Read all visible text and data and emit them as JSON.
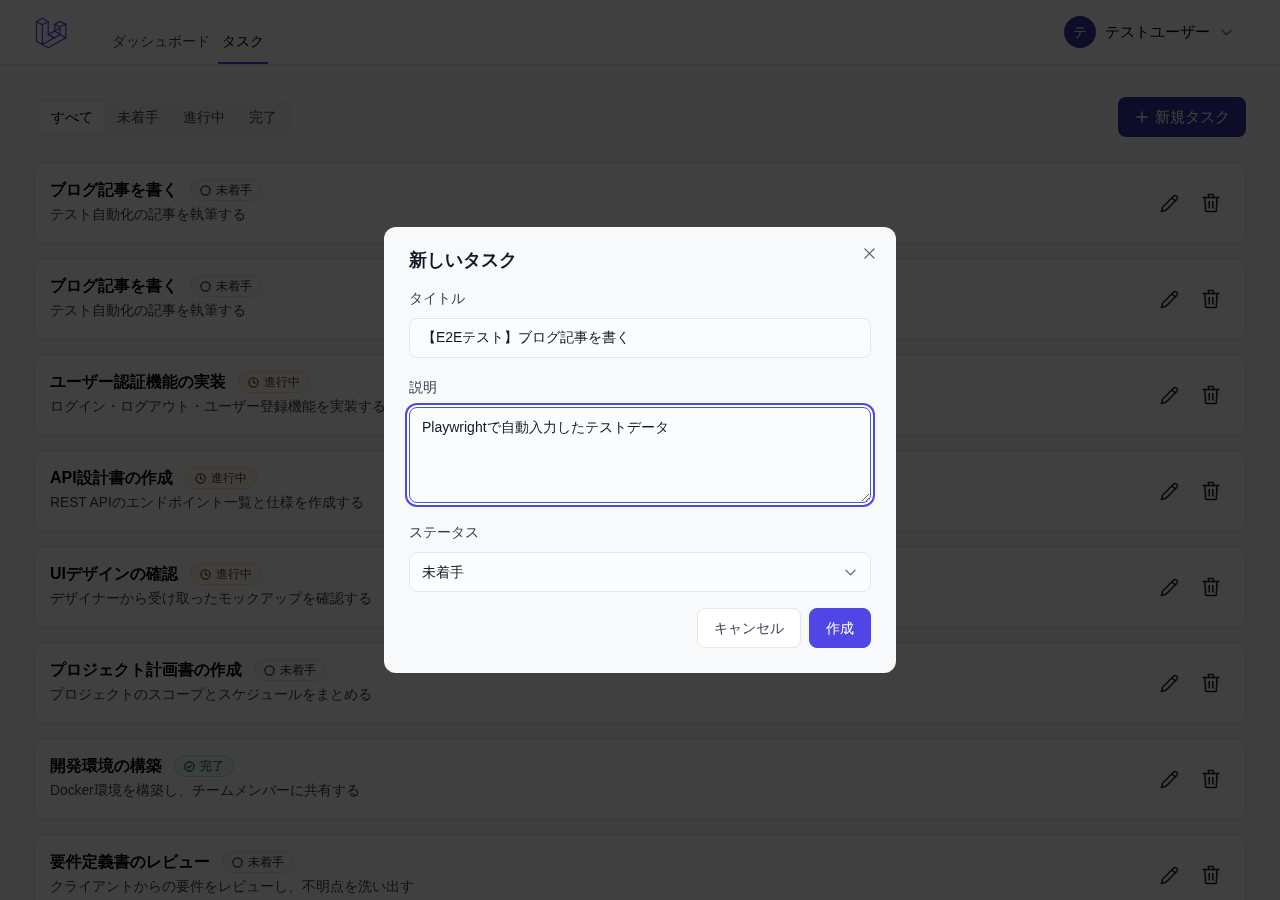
{
  "header": {
    "nav": [
      {
        "label": "ダッシュボード",
        "selected": false
      },
      {
        "label": "タスク",
        "selected": true
      }
    ],
    "user": {
      "avatar_initial": "テ",
      "name": "テストユーザー"
    }
  },
  "filters": [
    {
      "label": "すべて",
      "selected": true
    },
    {
      "label": "未着手",
      "selected": false
    },
    {
      "label": "進行中",
      "selected": false
    },
    {
      "label": "完了",
      "selected": false
    }
  ],
  "new_task_button": {
    "label": "新規タスク"
  },
  "tasks": [
    {
      "title": "ブログ記事を書く",
      "status": {
        "label": "未着手",
        "kind": "todo"
      },
      "description": "テスト自動化の記事を執筆する"
    },
    {
      "title": "ブログ記事を書く",
      "status": {
        "label": "未着手",
        "kind": "todo"
      },
      "description": "テスト自動化の記事を執筆する"
    },
    {
      "title": "ユーザー認証機能の実装",
      "status": {
        "label": "進行中",
        "kind": "in_progress"
      },
      "description": "ログイン・ログアウト・ユーザー登録機能を実装する"
    },
    {
      "title": "API設計書の作成",
      "status": {
        "label": "進行中",
        "kind": "in_progress"
      },
      "description": "REST APIのエンドポイント一覧と仕様を作成する"
    },
    {
      "title": "UIデザインの確認",
      "status": {
        "label": "進行中",
        "kind": "in_progress"
      },
      "description": "デザイナーから受け取ったモックアップを確認する"
    },
    {
      "title": "プロジェクト計画書の作成",
      "status": {
        "label": "未着手",
        "kind": "todo"
      },
      "description": "プロジェクトのスコープとスケジュールをまとめる"
    },
    {
      "title": "開発環境の構築",
      "status": {
        "label": "完了",
        "kind": "done"
      },
      "description": "Docker環境を構築し、チームメンバーに共有する"
    },
    {
      "title": "要件定義書のレビュー",
      "status": {
        "label": "未着手",
        "kind": "todo"
      },
      "description": "クライアントからの要件をレビューし、不明点を洗い出す"
    }
  ],
  "modal": {
    "title": "新しいタスク",
    "fields": [
      {
        "label": "タイトル",
        "kind": "text",
        "value": "【E2Eテスト】ブログ記事を書く",
        "focused": false
      },
      {
        "label": "説明",
        "kind": "textarea",
        "value": "Playwrightで自動入力したテストデータ",
        "focused": true
      },
      {
        "label": "ステータス",
        "kind": "select",
        "value": "未着手",
        "focused": false
      }
    ],
    "buttons": [
      {
        "label": "キャンセル",
        "kind": "secondary"
      },
      {
        "label": "作成",
        "kind": "primary"
      }
    ]
  }
}
